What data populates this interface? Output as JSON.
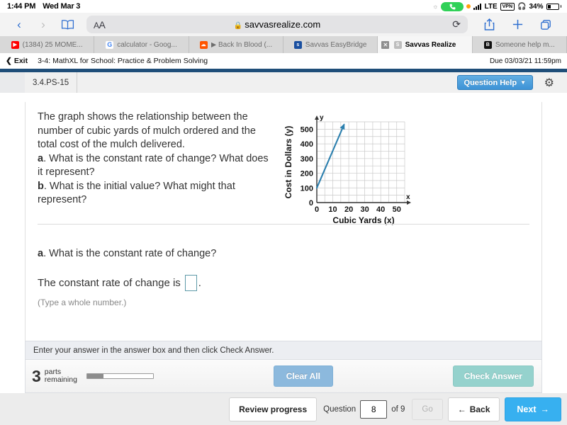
{
  "status_bar": {
    "time": "1:44 PM",
    "date": "Wed Mar 3",
    "brightness_icon": "brightness-icon",
    "call_icon": "phone-call-icon",
    "recording_dot": "orange-recording-dot",
    "signal_icon": "cellular-signal-icon",
    "network": "LTE",
    "vpn_badge": "VPN",
    "headphones_icon": "headphones-icon",
    "battery_percent": "34%",
    "battery_icon": "battery-icon"
  },
  "browser": {
    "back_icon": "back-chevron-icon",
    "forward_icon": "forward-chevron-icon",
    "bookmarks_icon": "book-bookmarks-icon",
    "text_size_label": "AA",
    "text_size_icon": "text-size-icon",
    "lock_icon": "lock-icon",
    "url": "savvasrealize.com",
    "reload_icon": "reload-icon",
    "share_icon": "share-icon",
    "new_tab_icon": "plus-icon",
    "tabs_overview_icon": "tabs-icon",
    "tabs": [
      {
        "label": "(1384) 25 MOME...",
        "favicon": "youtube-icon",
        "active": false
      },
      {
        "label": "calculator - Goog...",
        "favicon": "google-icon",
        "active": false
      },
      {
        "label": "▶ Back In Blood (...",
        "favicon": "soundcloud-icon",
        "active": false
      },
      {
        "label": "Savvas EasyBridge",
        "favicon": "savvas-easybridge-icon",
        "active": false
      },
      {
        "label": "Savvas Realize",
        "favicon": "savvas-realize-icon",
        "active": true,
        "close_icon": "close-icon"
      },
      {
        "label": "Someone help m...",
        "favicon": "brainly-icon",
        "active": false
      }
    ]
  },
  "app_header": {
    "exit_label": "Exit",
    "exit_icon": "chevron-left-icon",
    "assignment_title": "3-4: MathXL for School: Practice & Problem Solving",
    "due_label": "Due 03/03/21 11:59pm"
  },
  "question_header": {
    "question_id": "3.4.PS-15",
    "help_button_label": "Question Help",
    "help_caret_icon": "chevron-down-icon",
    "settings_icon": "gear-icon",
    "accent_color": "#3d93d6"
  },
  "question": {
    "prompt_line1": "The graph shows the relationship between the",
    "prompt_line2": "number of cubic yards of mulch ordered and the",
    "prompt_line3": "total cost of the mulch delivered.",
    "part_a_letter": "a",
    "part_a_text": ". What is the constant rate of change? What",
    "part_a_text2": "does it represent?",
    "part_b_letter": "b",
    "part_b_text": ". What is the initial value? What might that",
    "part_b_text2": "represent?"
  },
  "part_a": {
    "letter": "a",
    "question": ". What is the constant rate of change?",
    "answer_prefix": "The constant rate of change is",
    "answer_value": "",
    "answer_suffix": ".",
    "hint": "(Type a whole number.)"
  },
  "feedback": {
    "message": "Enter your answer in the answer box and then click Check Answer."
  },
  "action_bar": {
    "parts_count": "3",
    "parts_label_line1": "parts",
    "parts_label_line2": "remaining",
    "progress_percent": 25,
    "clear_all_label": "Clear All",
    "check_answer_label": "Check Answer"
  },
  "bottom_nav": {
    "review_progress_label": "Review progress",
    "question_word": "Question",
    "question_number": "8",
    "of_label": "of 9",
    "go_label": "Go",
    "back_label": "Back",
    "back_icon": "arrow-left-icon",
    "next_label": "Next",
    "next_icon": "arrow-right-icon",
    "next_color": "#37b0f0"
  },
  "chart_data": {
    "type": "line",
    "title": "",
    "xlabel": "Cubic Yards (x)",
    "ylabel": "Cost in Dollars (y)",
    "x_axis_name": "x",
    "y_axis_name": "y",
    "xticks": [
      0,
      10,
      20,
      30,
      40,
      50
    ],
    "yticks": [
      0,
      100,
      200,
      300,
      400,
      500
    ],
    "xlim": [
      0,
      55
    ],
    "ylim": [
      0,
      550
    ],
    "grid": true,
    "legend": "none",
    "series": [
      {
        "name": "Total cost of mulch",
        "color": "#2b7fae",
        "arrow_end": true,
        "points": [
          [
            0,
            100
          ],
          [
            17,
            530
          ]
        ],
        "intercept": 100,
        "slope": 25
      }
    ]
  }
}
